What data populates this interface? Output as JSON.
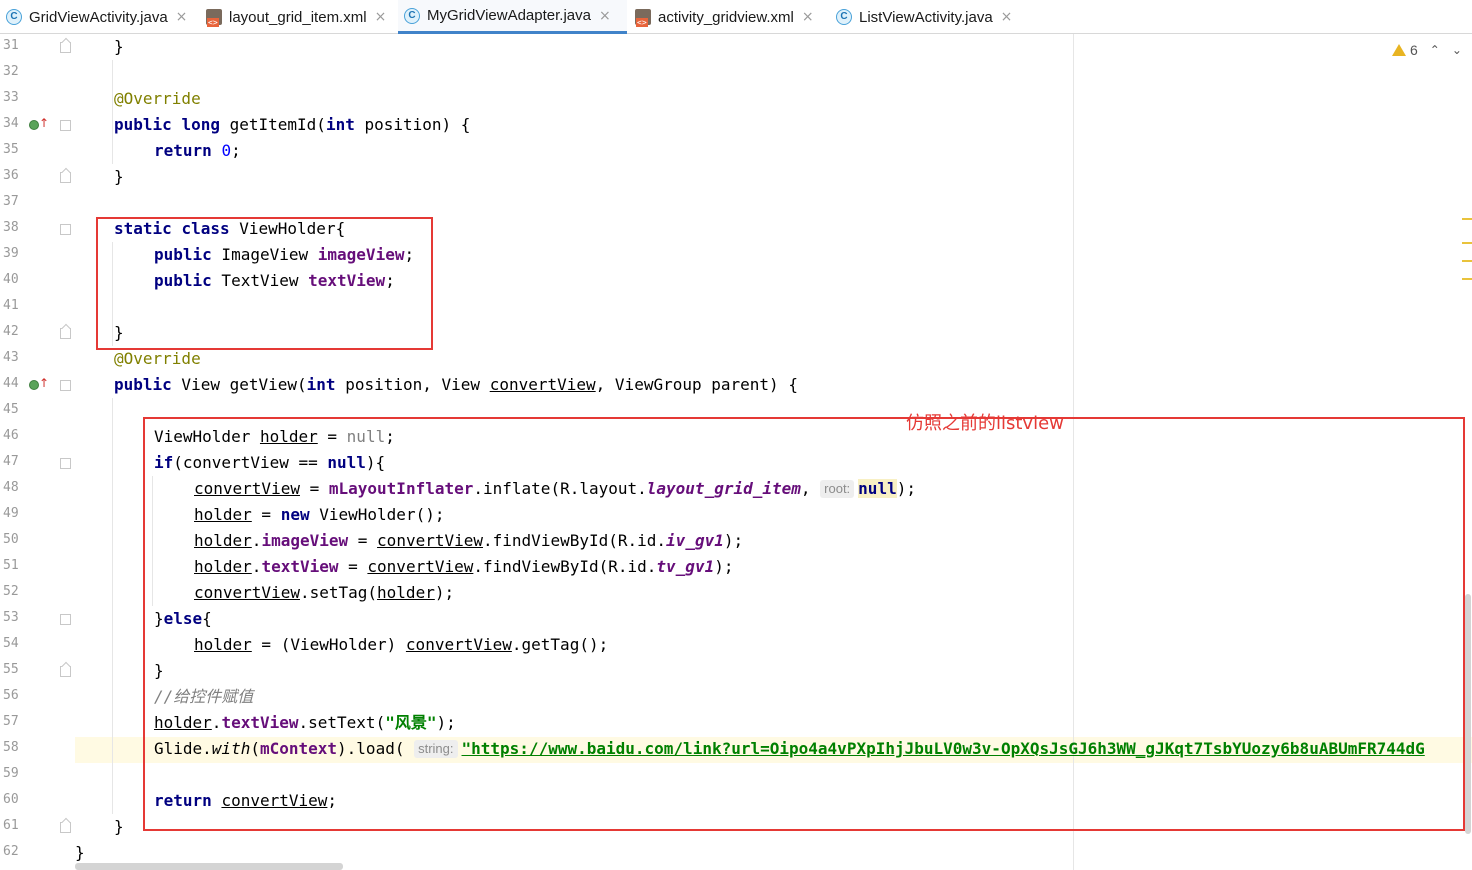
{
  "tabs": [
    {
      "label": "GridViewActivity.java",
      "icon": "java-class-icon",
      "active": false
    },
    {
      "label": "layout_grid_item.xml",
      "icon": "xml-file-icon",
      "active": false
    },
    {
      "label": "MyGridViewAdapter.java",
      "icon": "java-class-icon",
      "active": true
    },
    {
      "label": "activity_gridview.xml",
      "icon": "xml-file-icon",
      "active": false
    },
    {
      "label": "ListViewActivity.java",
      "icon": "java-class-icon",
      "active": false
    }
  ],
  "java_icon_letter": "C",
  "close_glyph": "×",
  "inspection": {
    "warning_count": "6",
    "up_glyph": "⌃",
    "down_glyph": "⌄"
  },
  "line_numbers": [
    "31",
    "32",
    "33",
    "34",
    "35",
    "36",
    "37",
    "38",
    "39",
    "40",
    "41",
    "42",
    "43",
    "44",
    "45",
    "46",
    "47",
    "48",
    "49",
    "50",
    "51",
    "52",
    "53",
    "54",
    "55",
    "56",
    "57",
    "58",
    "59",
    "60",
    "61",
    "62"
  ],
  "annotation_note": "仿照之前的listview",
  "code": {
    "l31": {
      "brace": "}"
    },
    "l33": {
      "ann": "@Override"
    },
    "l34": {
      "kw1": "public",
      "kw2": "long",
      "name": " getItemId(",
      "kw3": "int",
      "rest": " position) {"
    },
    "l35": {
      "kw": "return",
      "num": "0",
      "end": ";"
    },
    "l36": {
      "brace": "}"
    },
    "l38": {
      "kw1": "static",
      "kw2": "class",
      "rest": " ViewHolder{"
    },
    "l39": {
      "kw": "public",
      "type": " ImageView ",
      "field": "imageView",
      "end": ";"
    },
    "l40": {
      "kw": "public",
      "type": " TextView ",
      "field": "textView",
      "end": ";"
    },
    "l42": {
      "brace": "}"
    },
    "l43": {
      "ann": "@Override"
    },
    "l44": {
      "kw1": "public",
      "t1": " View getView(",
      "kw2": "int",
      "t2": " position, View ",
      "p1": "convertView",
      "t3": ", ViewGroup parent) {"
    },
    "l46": {
      "t1": "ViewHolder ",
      "v1": "holder",
      "t2": " = ",
      "kw": "null",
      "end": ";"
    },
    "l47": {
      "kw1": "if",
      "t1": "(convertView == ",
      "kw2": "null",
      "t2": "){"
    },
    "l48": {
      "v1": "convertView",
      "t1": " = ",
      "f1": "mLayoutInflater",
      "t2": ".inflate(R.layout.",
      "f2": "layout_grid_item",
      "t3": ", ",
      "hint": "root:",
      "kw": "null",
      "t4": ");"
    },
    "l49": {
      "v1": "holder",
      "t1": " = ",
      "kw": "new",
      "t2": " ViewHolder();"
    },
    "l50": {
      "v1": "holder",
      "t1": ".",
      "f1": "imageView",
      "t2": " = ",
      "v2": "convertView",
      "t3": ".findViewById(R.id.",
      "f2": "iv_gv1",
      "t4": ");"
    },
    "l51": {
      "v1": "holder",
      "t1": ".",
      "f1": "textView",
      "t2": " = ",
      "v2": "convertView",
      "t3": ".findViewById(R.id.",
      "f2": "tv_gv1",
      "t4": ");"
    },
    "l52": {
      "v1": "convertView",
      "t1": ".setTag(",
      "v2": "holder",
      "t2": ");"
    },
    "l53": {
      "t1": "}",
      "kw": "else",
      "t2": "{"
    },
    "l54": {
      "v1": "holder",
      "t1": " = (ViewHolder) ",
      "v2": "convertView",
      "t2": ".getTag();"
    },
    "l55": {
      "brace": "}"
    },
    "l56": {
      "comment": "//给控件赋值"
    },
    "l57": {
      "v1": "holder",
      "t1": ".",
      "f1": "textView",
      "t2": ".setText(",
      "s": "\"风景\"",
      "t3": ");"
    },
    "l58": {
      "t1": "Glide.",
      "m": "with",
      "t2": "(",
      "f1": "mContext",
      "t3": ").load( ",
      "hint": "string:",
      "s": "\"https://www.baidu.com/link?url=Oipo4a4vPXpIhjJbuLV0w3v-OpXQsJsGJ6h3WW_gJKqt7TsbYUozy6b8uABUmFR744dG"
    },
    "l60": {
      "kw": "return",
      "t1": " ",
      "v1": "convertView",
      "end": ";"
    },
    "l61": {
      "brace": "}"
    },
    "l62": {
      "brace": "}"
    }
  }
}
